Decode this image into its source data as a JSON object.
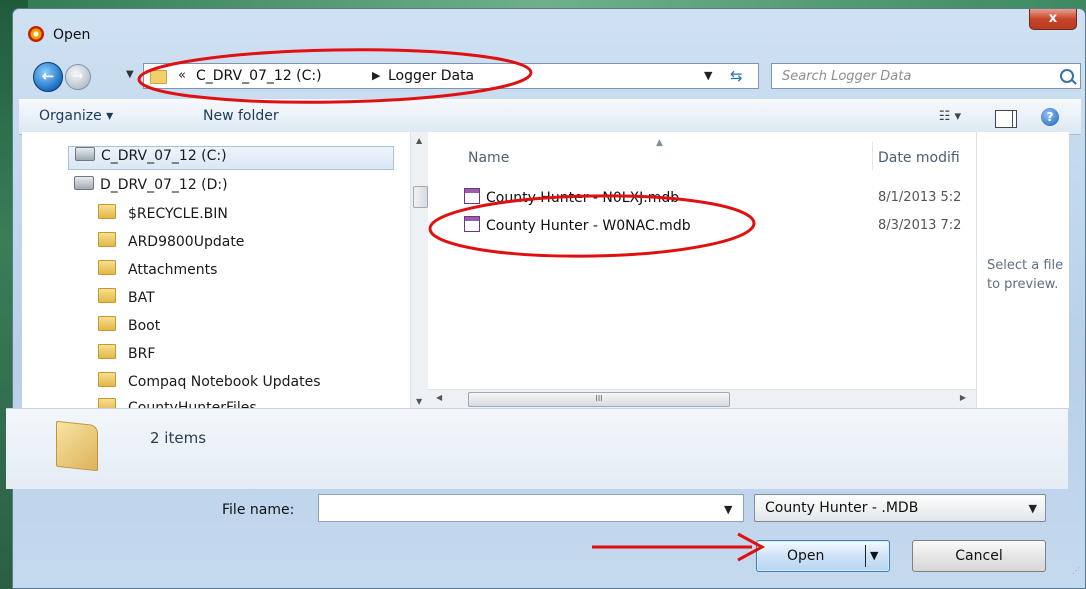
{
  "window": {
    "title": "Open",
    "close_label": "x"
  },
  "nav": {
    "address_chevron": "«",
    "path": [
      "C_DRV_07_12 (C:)",
      "Logger Data"
    ],
    "search_placeholder": "Search Logger Data"
  },
  "toolbar": {
    "organize_label": "Organize ▾",
    "new_folder_label": "New folder"
  },
  "tree": {
    "items": [
      {
        "label": "C_DRV_07_12 (C:)",
        "kind": "drive",
        "selected": true
      },
      {
        "label": "D_DRV_07_12 (D:)",
        "kind": "drive"
      },
      {
        "label": "$RECYCLE.BIN",
        "kind": "folder"
      },
      {
        "label": "ARD9800Update",
        "kind": "folder"
      },
      {
        "label": "Attachments",
        "kind": "folder"
      },
      {
        "label": "BAT",
        "kind": "folder"
      },
      {
        "label": "Boot",
        "kind": "folder"
      },
      {
        "label": "BRF",
        "kind": "folder"
      },
      {
        "label": "Compaq Notebook Updates",
        "kind": "folder"
      },
      {
        "label": "CountyHunterFiles",
        "kind": "folder"
      }
    ]
  },
  "files": {
    "columns": {
      "name": "Name",
      "date": "Date modifi"
    },
    "rows": [
      {
        "name": "County Hunter - N0LXJ.mdb",
        "date": "8/1/2013 5:2"
      },
      {
        "name": "County Hunter - W0NAC.mdb",
        "date": "8/3/2013 7:2"
      }
    ],
    "hscroll_thumb_label": "III"
  },
  "preview": {
    "line1": "Select a file",
    "line2": "to preview."
  },
  "details": {
    "item_count": "2 items"
  },
  "bottom": {
    "file_name_label": "File name:",
    "file_name_value": "",
    "file_type_value": "County Hunter - .MDB",
    "open_label": "Open",
    "cancel_label": "Cancel"
  },
  "colors": {
    "annotation_red": "#e01010",
    "accent_blue": "#3c7fb1"
  }
}
